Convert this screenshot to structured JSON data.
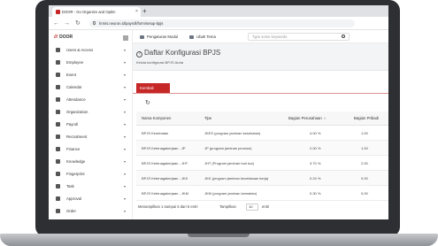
{
  "browser": {
    "tab_title": "DOOR - Go Organize and Optim",
    "tab_close": "×",
    "new_tab": "+",
    "back": "←",
    "forward": "→",
    "reload": "↻",
    "url": "hrmis.neuron.id/payroll/form/setup-bpjs"
  },
  "app": {
    "logo": "DOOR",
    "logo_mark": "///"
  },
  "sidebar": {
    "items": [
      {
        "label": "Users & Access",
        "icon": "user-icon",
        "has_chevron": true
      },
      {
        "label": "Employee",
        "icon": "employee-icon",
        "has_chevron": true
      },
      {
        "label": "Event",
        "icon": "event-icon",
        "has_chevron": true
      },
      {
        "label": "Calendar",
        "icon": "calendar-icon",
        "has_chevron": true
      },
      {
        "label": "Attendance",
        "icon": "attendance-icon",
        "has_chevron": true
      },
      {
        "label": "Organization",
        "icon": "organization-icon",
        "has_chevron": true
      },
      {
        "label": "Payroll",
        "icon": "payroll-icon",
        "has_chevron": true
      },
      {
        "label": "Recruitment",
        "icon": "recruitment-icon",
        "has_chevron": true
      },
      {
        "label": "Finance",
        "icon": "finance-icon",
        "has_chevron": true
      },
      {
        "label": "Knowledge",
        "icon": "knowledge-icon",
        "has_chevron": true
      },
      {
        "label": "Fingerprint",
        "icon": "fingerprint-icon",
        "has_chevron": true
      },
      {
        "label": "Task",
        "icon": "task-icon",
        "has_chevron": true
      },
      {
        "label": "Approval",
        "icon": "approval-icon",
        "has_chevron": true
      },
      {
        "label": "Order",
        "icon": "order-icon",
        "has_chevron": true
      }
    ]
  },
  "topbar": {
    "settings_label": "Pengaturan Modul",
    "theme_label": "Ubah Tema",
    "search_placeholder": "Type some keywords"
  },
  "page": {
    "title": "Daftar Konfigurasi BPJS",
    "help_glyph": "?",
    "subtitle": "Kelola konfigurasi BPJS Anda",
    "back_button": "Kembali",
    "refresh_glyph": "↻"
  },
  "table": {
    "headers": [
      "Nama Komponen",
      "Tipe",
      "Bagian Perusahaan",
      "Bagian Pribadi"
    ],
    "sort_glyph": "⇅",
    "rows": [
      [
        "BPJS Kesehatan",
        "JKES (program jaminan kesehatan)",
        "4.00 %",
        "1.00"
      ],
      [
        "BPJS Ketenagakerjaan - JP",
        "JP (program jaminan pensiun)",
        "2.00 %",
        "1.00"
      ],
      [
        "BPJS Ketenagakerjaan - JHT",
        "JHT (Program jaminan hari tua)",
        "3.70 %",
        "2.00"
      ],
      [
        "BPJS Ketenagakerjaan - JKK",
        "JKK (program jaminan kecelakaan kerja)",
        "0.24 %",
        "0.00"
      ],
      [
        "BPJS Ketenagakerjaan - JKM",
        "JKM (program jaminan kematian)",
        "0.30 %",
        "0.00"
      ]
    ]
  },
  "footer": {
    "showing": "Menampilkan 1 sampai 5 dari 5 entri",
    "show_label": "Tampilkan",
    "page_size": "10",
    "entries_label": "entri"
  },
  "colors": {
    "accent": "#c62828",
    "laptop": "#2d2f33"
  }
}
